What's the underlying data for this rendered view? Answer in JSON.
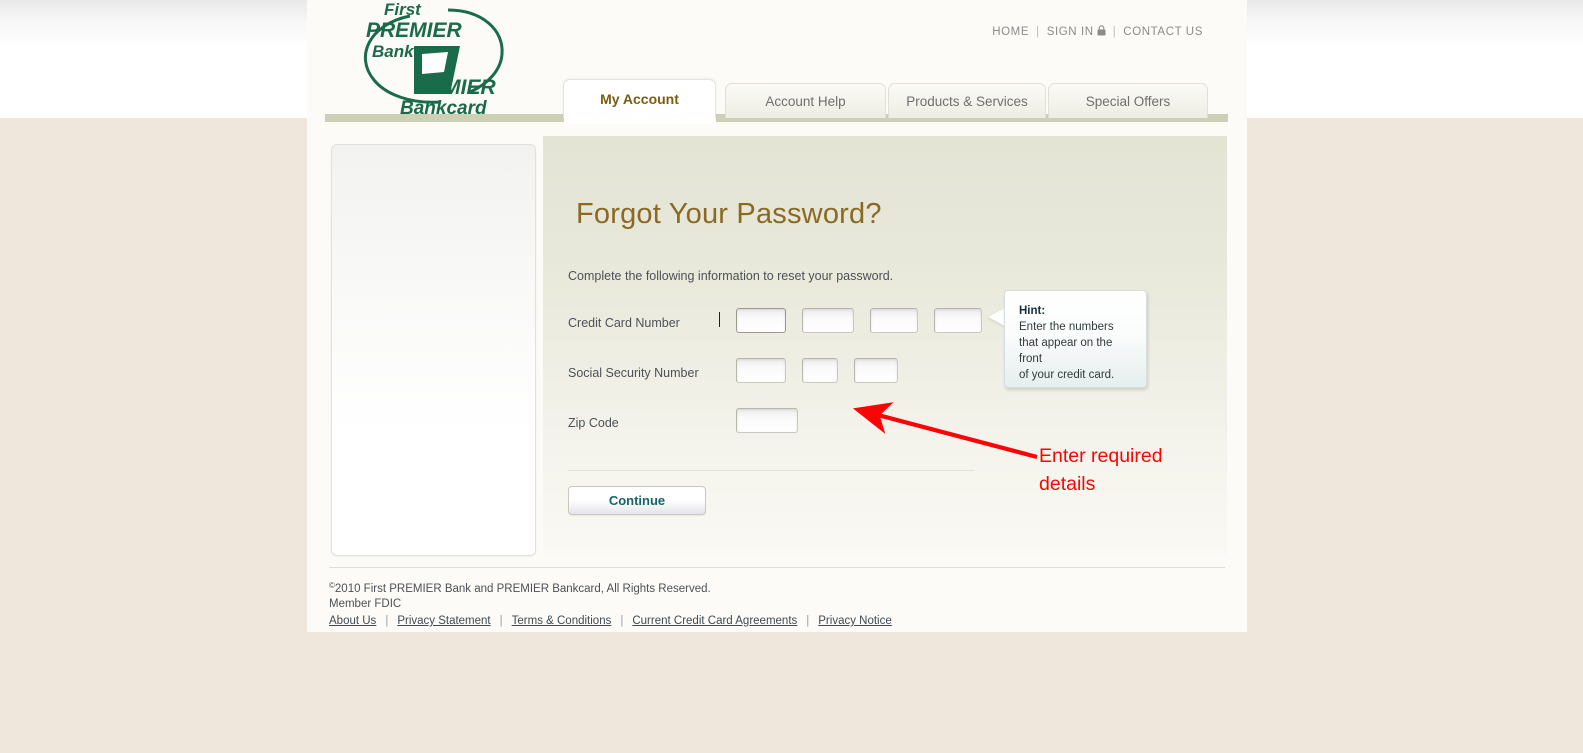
{
  "brand": {
    "logo_line1": "First",
    "logo_line2": "PREMIER",
    "logo_line3": "Bank",
    "logo_line4": "PREMIER",
    "logo_line5": "Bankcard",
    "logo_color": "#1a6b4a"
  },
  "topnav": {
    "home": "HOME",
    "signin": "SIGN IN",
    "contact": "CONTACT US",
    "separator": "|",
    "lock_icon": "lock-icon"
  },
  "tabs": [
    {
      "label": "My Account",
      "active": true
    },
    {
      "label": "Account Help",
      "active": false
    },
    {
      "label": "Products & Services",
      "active": false
    },
    {
      "label": "Special Offers",
      "active": false
    }
  ],
  "main": {
    "title": "Forgot Your Password?",
    "title_color": "#8a6a23",
    "subtitle": "Complete the following information to reset your password.",
    "fields": [
      {
        "label": "Credit Card Number",
        "inputs": [
          {
            "value": "",
            "width": "w50",
            "focused": true
          },
          {
            "value": "",
            "width": "w52",
            "focused": false
          },
          {
            "value": "",
            "width": "w48",
            "focused": false
          },
          {
            "value": "",
            "width": "w48",
            "focused": false
          }
        ]
      },
      {
        "label": "Social Security Number",
        "inputs": [
          {
            "value": "",
            "width": "w50",
            "focused": false
          },
          {
            "value": "",
            "width": "w36",
            "focused": false
          },
          {
            "value": "",
            "width": "w44",
            "focused": false
          }
        ]
      },
      {
        "label": "Zip Code",
        "inputs": [
          {
            "value": "",
            "width": "w62",
            "focused": false
          }
        ]
      }
    ],
    "continue_label": "Continue"
  },
  "hint": {
    "title": "Hint:",
    "line1": "Enter the numbers",
    "line2": "that appear on the front",
    "line3": "of your credit card."
  },
  "annotation": {
    "text": "Enter required\ndetails",
    "color": "#fa0505"
  },
  "footer": {
    "copyright": "2010 First PREMIER Bank and PREMIER Bankcard, All Rights Reserved.",
    "copyright_symbol": "©",
    "member": "Member FDIC",
    "links": [
      "About Us",
      "Privacy Statement",
      "Terms & Conditions",
      "Current Credit Card Agreements",
      "Privacy Notice"
    ],
    "separator": "|"
  }
}
